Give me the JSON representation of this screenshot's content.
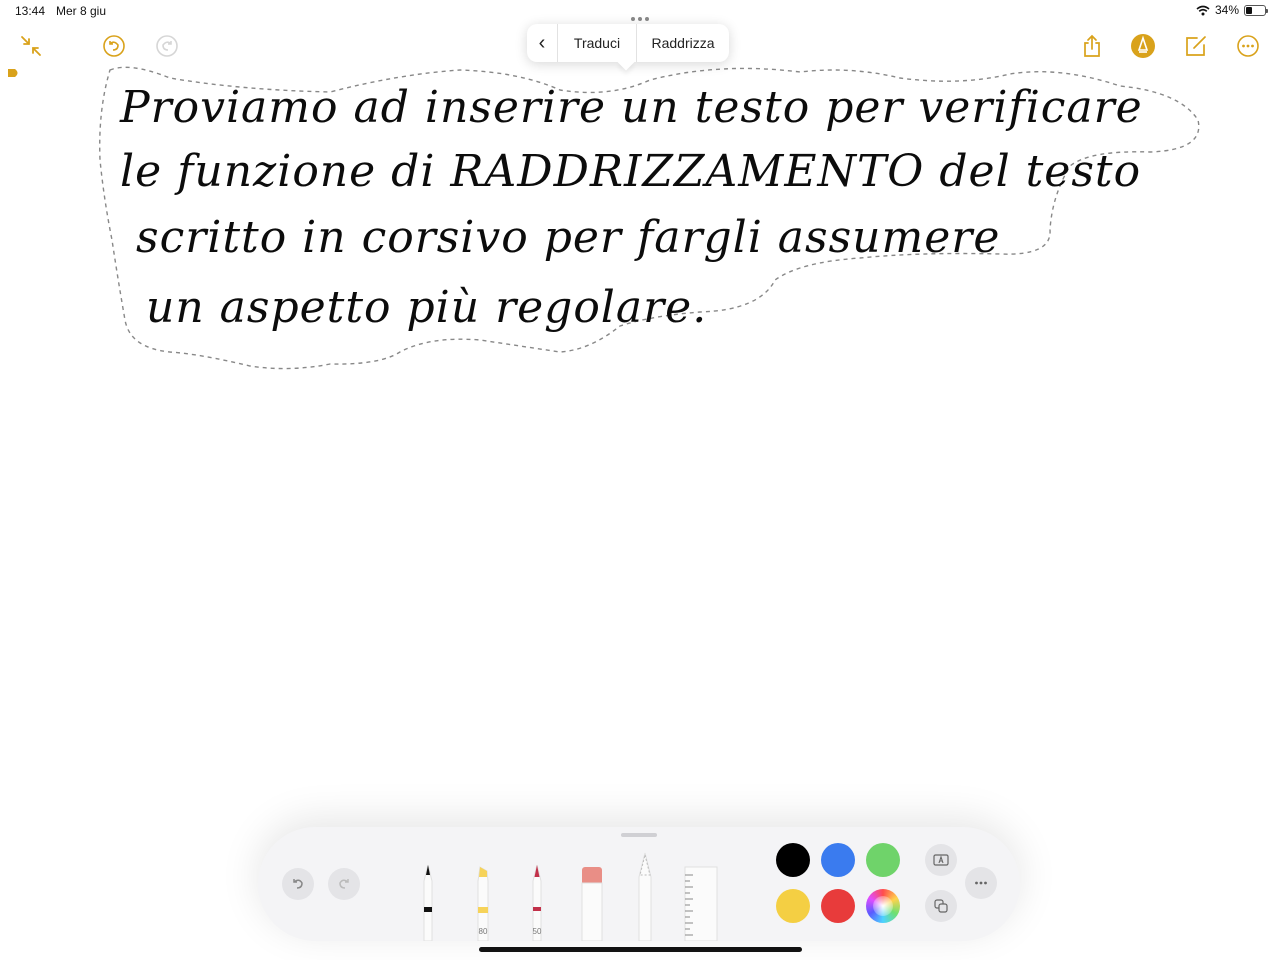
{
  "status_bar": {
    "time": "13:44",
    "date": "Mer 8 giu",
    "battery_percent_text": "34%",
    "battery_level": 0.34
  },
  "toolbar": {
    "left_icons": [
      "minimize-arrows-icon",
      "undo-circle-icon",
      "redo-circle-icon",
      "tag-icon"
    ],
    "right_icons": [
      "share-icon",
      "markup-pen-icon",
      "compose-icon",
      "more-icon"
    ],
    "accent_color": "#D9A21B"
  },
  "context_menu": {
    "back_label": "‹",
    "translate_label": "Traduci",
    "straighten_label": "Raddrizza"
  },
  "handwriting": {
    "lines": [
      "Proviamo ad inserire un testo per verificare",
      "le funzione di RADDRIZZAMENTO del testo",
      "scritto in corsivo per fargli assumere",
      "un aspetto più regolare."
    ]
  },
  "palette": {
    "highlighter_label": "80",
    "crayon_label": "50",
    "colors": [
      "#000000",
      "#3A7BEF",
      "#6FD36A",
      "#F4CF43",
      "#E83B3B"
    ],
    "background": "#F4F4F6"
  }
}
